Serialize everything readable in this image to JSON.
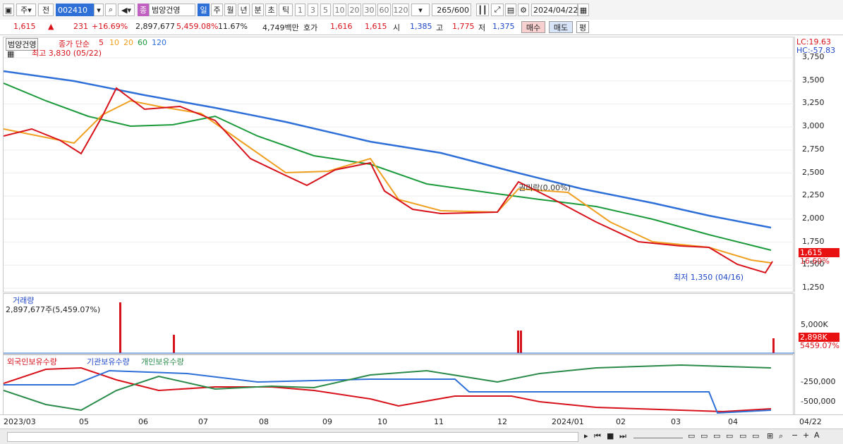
{
  "toolbar": {
    "market_prefix": "주",
    "market_type": "전",
    "code": "002410",
    "name_badge": "종",
    "name": "범양건영",
    "periods": [
      "일",
      "주",
      "월",
      "년",
      "분",
      "초",
      "틱"
    ],
    "selected_period": "일",
    "intervals": [
      "1",
      "3",
      "5",
      "10",
      "20",
      "30",
      "60",
      "120"
    ],
    "count": "265",
    "count_total": "/600",
    "date": "2024/04/22"
  },
  "info": {
    "price": "1,615",
    "change": "231",
    "change_pct": "+16.69%",
    "volume": "2,897,677",
    "vol_ratio": "5,459.08%",
    "turnover": "11.67%",
    "amount": "4,749백만",
    "bid_label": "호가",
    "bid": "1,616",
    "ask": "1,615",
    "open_label": "시",
    "open": "1,385",
    "high_label": "고",
    "high": "1,775",
    "low_label": "저",
    "low": "1,375",
    "buy_button": "매수",
    "sell_button": "매도",
    "eval_button": "평"
  },
  "price_panel": {
    "title": "범양건영",
    "legend_prefix": "종가 단순",
    "ma_labels": [
      "5",
      "10",
      "20",
      "60",
      "120"
    ],
    "ma_colors": [
      "#d8121b",
      "#f0a020",
      "#f0a020",
      "#1a9a3a",
      "#2e6fd8"
    ],
    "high_note": "최고 3,830 (05/22)",
    "low_note": "최저 1,350 (04/16)",
    "event_note": "권리락(0.00%)",
    "lc": "LC:19.63",
    "hc": "HC:-57.83",
    "current_price": "1,615",
    "current_pct": "16.69%",
    "y_ticks": [
      "3,750",
      "3,500",
      "3,250",
      "3,000",
      "2,750",
      "2,500",
      "2,250",
      "2,000",
      "1,750",
      "1,500",
      "1,250"
    ]
  },
  "volume_panel": {
    "title": "거래량",
    "value": "2,897,677주(5,459.07%)",
    "y_tick": "5,000K",
    "current": "2,898K",
    "current_pct": "5459.07%"
  },
  "holdings_panel": {
    "legends": [
      "외국인보유수량",
      "기관보유수량",
      "개인보유수량"
    ],
    "colors": [
      "#d8121b",
      "#2e6fd8",
      "#2a8a4a"
    ],
    "y_ticks": [
      "-250,000",
      "-500,000"
    ]
  },
  "x_axis": [
    "2023/03",
    "05",
    "06",
    "07",
    "08",
    "09",
    "10",
    "11",
    "12",
    "2024/01",
    "02",
    "03",
    "04",
    "04/22"
  ]
}
